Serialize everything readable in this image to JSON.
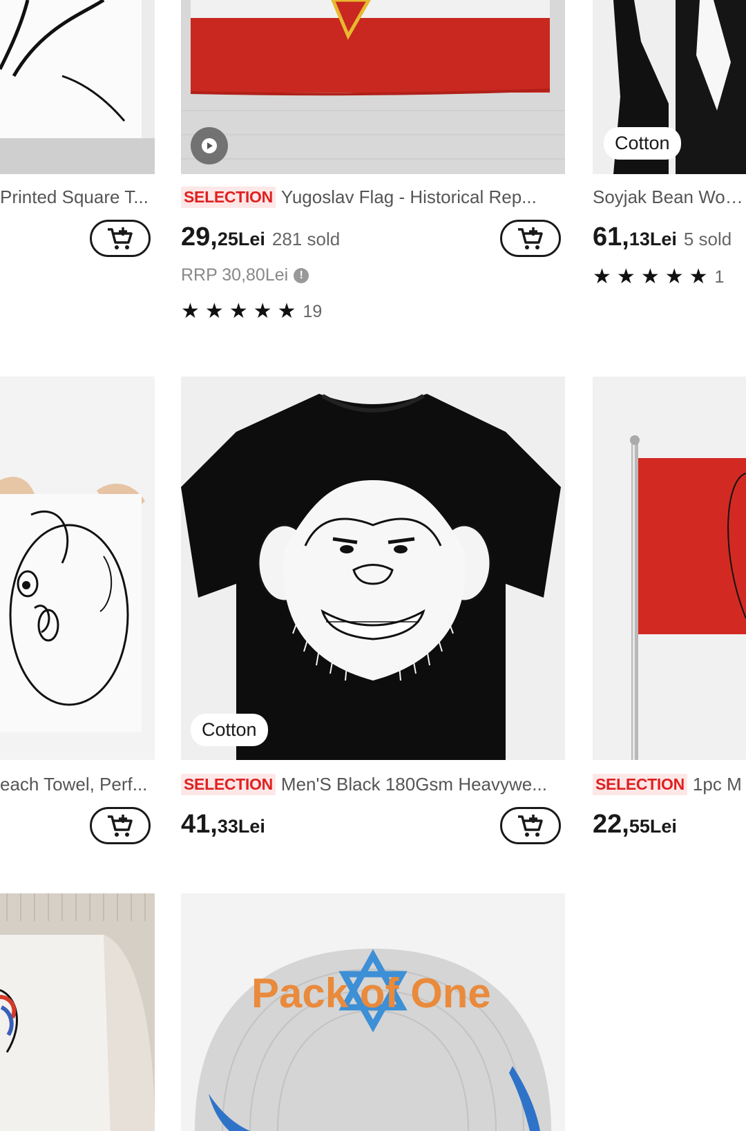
{
  "colors": {
    "selection_red": "#e02020",
    "selection_bg": "#fde7e7",
    "price_text": "#191919",
    "muted_text": "#666666",
    "flag_red": "#d22a22",
    "star_gold": "#f2c518"
  },
  "icons": {
    "cart": "cart-add-icon",
    "star": "star-icon",
    "play": "play-icon",
    "info": "info-icon"
  },
  "products": [
    {
      "id": "left-top",
      "title": "Printed Square T...",
      "selection": false
    },
    {
      "id": "mid-top",
      "selection_label": "SELECTION",
      "title": "Yugoslav Flag - Historical Rep...",
      "price_int": "29,",
      "price_dec": "25Lei",
      "sold": "281 sold",
      "rrp": "RRP 30,80Lei",
      "rating_count": "19"
    },
    {
      "id": "right-top",
      "tag": "Cotton",
      "title": "Soyjak Bean Wojak",
      "price_int": "61,",
      "price_dec": "13Lei",
      "sold": "5 sold",
      "rating_count": "1"
    },
    {
      "id": "left-mid",
      "title": "each Towel, Perf..."
    },
    {
      "id": "mid-mid",
      "tag": "Cotton",
      "selection_label": "SELECTION",
      "title": "Men'S Black 180Gsm Heavywe...",
      "price_int": "41,",
      "price_dec": "33Lei"
    },
    {
      "id": "right-mid",
      "selection_label": "SELECTION",
      "title": "1pc M",
      "price_int": "22,",
      "price_dec": "55Lei"
    },
    {
      "id": "mid-bottom",
      "overlay_text": "Pack of One"
    }
  ]
}
